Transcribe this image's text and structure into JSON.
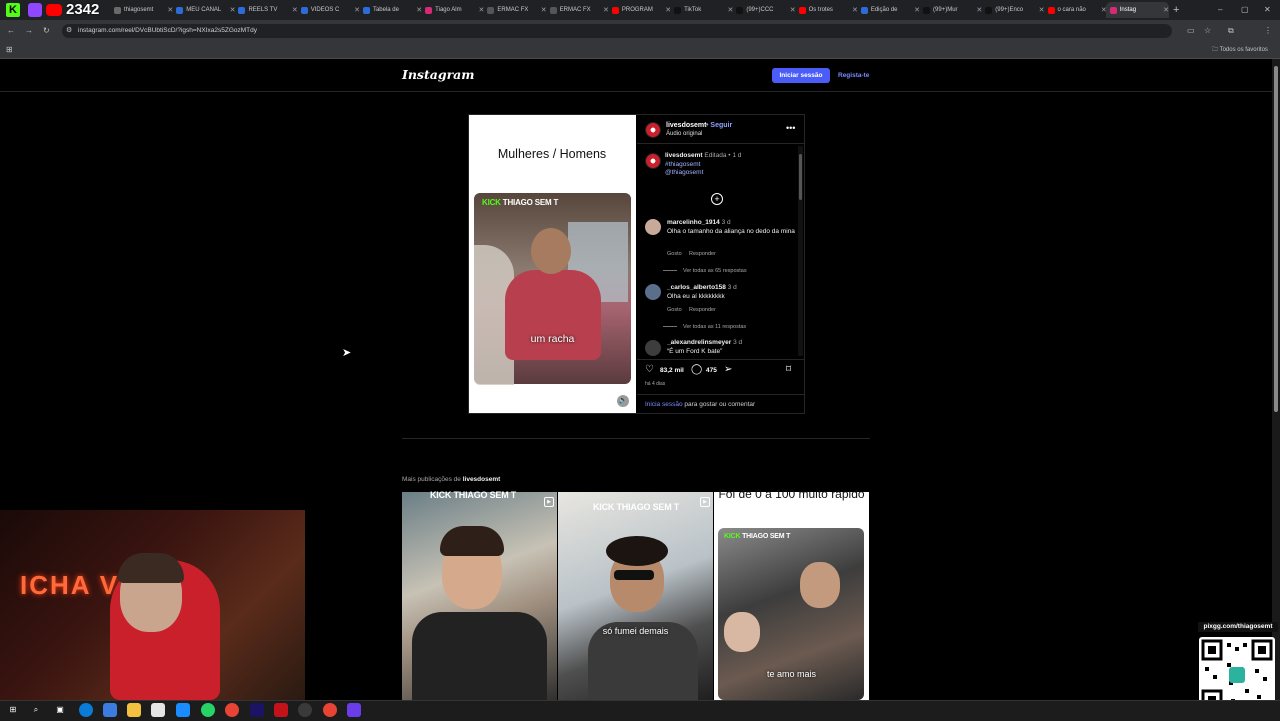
{
  "stream": {
    "viewer_count": "2342",
    "kick_letter": "K"
  },
  "browser": {
    "url": "instagram.com/reel/DVcBUbtiScD/?igsh=NXIxa2s5ZGozMTdy",
    "bookmarks_label": "Todos os favoritos",
    "tabs": [
      {
        "label": "thiagosemt",
        "color": "#6a6a6a"
      },
      {
        "label": "MEU CANAL",
        "color": "#2b6cd9"
      },
      {
        "label": "REELS TV",
        "color": "#2b6cd9"
      },
      {
        "label": "VIDEOS C",
        "color": "#2b6cd9"
      },
      {
        "label": "Tabela de",
        "color": "#2b6cd9"
      },
      {
        "label": "Tiago Alm",
        "color": "#d62976"
      },
      {
        "label": "ERMAC FX",
        "color": "#555555"
      },
      {
        "label": "ERMAC FX",
        "color": "#555555"
      },
      {
        "label": "PROGRAM",
        "color": "#ff0000"
      },
      {
        "label": "TikTok",
        "color": "#111111"
      },
      {
        "label": "(99+)CCC",
        "color": "#111111"
      },
      {
        "label": "Os trotes",
        "color": "#ff0000"
      },
      {
        "label": "Edição de",
        "color": "#2b6cd9"
      },
      {
        "label": "(99+)Mur",
        "color": "#111111"
      },
      {
        "label": "(99+)Enco",
        "color": "#111111"
      },
      {
        "label": "o cara não",
        "color": "#ff0000"
      },
      {
        "label": "Instag",
        "color": "#d62976"
      }
    ]
  },
  "header": {
    "logo": "Instagram",
    "login_label": "Iniciar sessão",
    "signup_label": "Regista-te"
  },
  "post": {
    "media_title": "Mulheres / Homens",
    "video_kick": "KICK",
    "video_channel": "THIAGO SEM T",
    "video_caption": "um racha",
    "username": "livesdosemt",
    "follow_label": "Seguir",
    "audio_label": "Áudio original",
    "caption_user": "livesdosemt",
    "caption_meta": "Editada • 1 d",
    "caption_hashtag": "#thiagosemt",
    "caption_mention": "@thiagosemt",
    "comments": [
      {
        "user": "marcelinho_1914",
        "age": "3 d",
        "text": "Olha o tamanho da aliança no dedo da mina",
        "like": "Gosto",
        "reply": "Responder",
        "replies": "Ver todas as 65 respostas"
      },
      {
        "user": "_carlos_alberto158",
        "age": "3 d",
        "text": "Olha eu aí kkkkkkkk",
        "like": "Gosto",
        "reply": "Responder",
        "replies": "Ver todas as 11 respostas"
      },
      {
        "user": "_alexandrelinsmeyer",
        "age": "3 d",
        "text": "“É um Ford K bate”"
      }
    ],
    "likes": "83,2 mil",
    "comment_count": "475",
    "time": "há 4 dias",
    "login_prompt_link": "Inicia sessão",
    "login_prompt_rest": " para gostar ou comentar"
  },
  "more": {
    "label": "Mais publicações de",
    "user": "livesdosemt",
    "thumbs": [
      {
        "top": "KICK THIAGO SEM T",
        "caption": ""
      },
      {
        "top": "KICK THIAGO SEM T",
        "caption": "só fumei demais"
      },
      {
        "top": "Foi de 0 a 100 muito rápido",
        "caption": "te amo mais"
      }
    ]
  },
  "overlay": {
    "pix_label": "pixgg.com/thiagosemt",
    "neon": "ICHA VIA"
  }
}
